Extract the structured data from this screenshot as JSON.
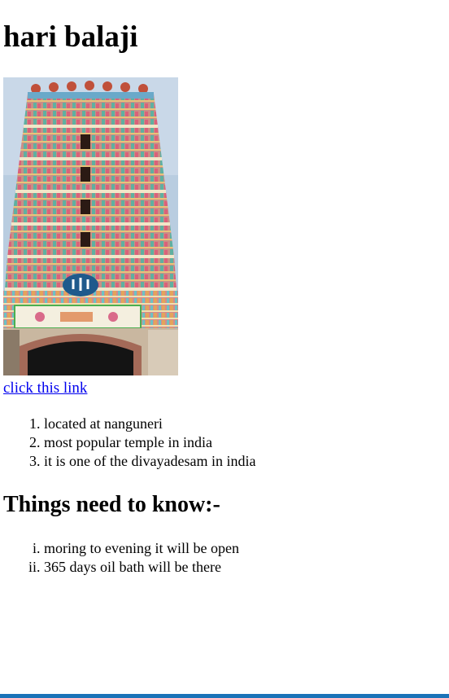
{
  "page": {
    "title": "hari balaji",
    "image_alt": "temple gopuram",
    "link_text": "click this link",
    "list1": [
      "located at nanguneri",
      "most popular temple in india",
      "it is one of the divayadesam in india"
    ],
    "heading2": "Things need to know:-",
    "list2": [
      "moring to evening it will be open",
      "365 days oil bath will be there"
    ]
  },
  "colors": {
    "link": "#0000ee",
    "bottom_bar": "#1a73b8"
  }
}
